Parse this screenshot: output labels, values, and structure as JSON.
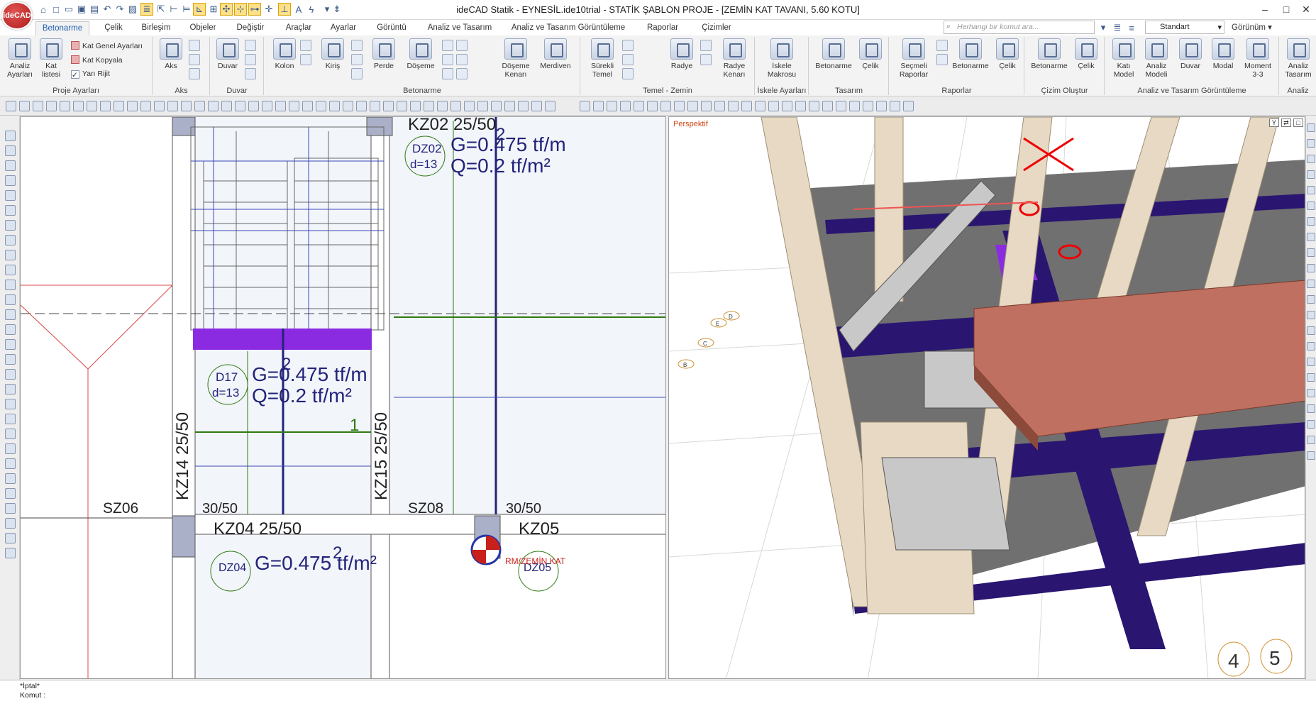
{
  "app": {
    "logo_text": "ideCAD",
    "window_title": "ideCAD Statik - EYNESİL.ide10trial - STATİK ŞABLON PROJE - [ZEMİN KAT TAVANI,  5.60 KOTU]"
  },
  "tabs": [
    "Betonarme",
    "Çelik",
    "Birleşim",
    "Objeler",
    "Değiştir",
    "Araçlar",
    "Ayarlar",
    "Görüntü",
    "Analiz ve Tasarım",
    "Analiz ve Tasarım Görüntüleme",
    "Raporlar",
    "Çizimler"
  ],
  "search": {
    "placeholder": "Herhangi bir komut ara..."
  },
  "style_select": {
    "value": "Standart"
  },
  "view_label": "Görünüm",
  "ribbon": {
    "groups": [
      {
        "label": "Proje Ayarları"
      },
      {
        "label": "Aks"
      },
      {
        "label": "Duvar"
      },
      {
        "label": "Betonarme"
      },
      {
        "label": "Temel - Zemin"
      },
      {
        "label": "İskele Ayarları"
      },
      {
        "label": "Tasarım"
      },
      {
        "label": "Raporlar"
      },
      {
        "label": "Çizim Oluştur"
      },
      {
        "label": "Analiz ve Tasarım Görüntüleme"
      },
      {
        "label": "Analiz"
      }
    ],
    "proje": {
      "analiz_l1": "Analiz",
      "analiz_l2": "Ayarları",
      "kat_l1": "Kat",
      "kat_l2": "listesi",
      "kat_genel": "Kat Genel Ayarları",
      "kat_kopyala": "Kat Kopyala",
      "yari_rijit": "Yarı Rijit"
    },
    "aks": {
      "l1": "Aks"
    },
    "duvar": {
      "l1": "Duvar"
    },
    "betonarme": {
      "kolon": "Kolon",
      "kiris": "Kiriş",
      "perde": "Perde",
      "doseme": "Döşeme",
      "doseme_kenari_l1": "Döşeme",
      "doseme_kenari_l2": "Kenarı",
      "merdiven": "Merdiven"
    },
    "temel": {
      "surekli_l1": "Sürekli",
      "surekli_l2": "Temel",
      "radye": "Radye",
      "radye_kenari_l1": "Radye",
      "radye_kenari_l2": "Kenarı"
    },
    "iskele": {
      "l1": "İskele",
      "l2": "Makrosu"
    },
    "tasarim": {
      "betonarme": "Betonarme",
      "celik": "Çelik"
    },
    "raporlar": {
      "secmeli_l1": "Seçmeli",
      "secmeli_l2": "Raporlar",
      "betonarme": "Betonarme",
      "celik": "Çelik"
    },
    "cizim": {
      "betonarme": "Betonarme",
      "celik": "Çelik"
    },
    "gorunt": {
      "kati_l1": "Katı",
      "kati_l2": "Model",
      "analiz_l1": "Analiz",
      "analiz_l2": "Modeli",
      "duvar": "Duvar",
      "modal": "Modal",
      "moment_l1": "Moment",
      "moment_l2": "3-3"
    },
    "analiz": {
      "l1": "Analiz",
      "l2": "Tasarım"
    }
  },
  "plan": {
    "labels": {
      "kz02": "KZ02 25/50",
      "kz04": "KZ04 25/50",
      "kz05": "KZ05",
      "kz14": "KZ14 25/50",
      "kz15": "KZ15 25/50",
      "sz06": "SZ06",
      "sz08": "SZ08",
      "c30a": "30/50",
      "c30b": "30/50",
      "dz02": "DZ02",
      "dz02_d": "d=13",
      "d17": "D17",
      "d17_d": "d=13",
      "dz04": "DZ04",
      "dz05": "DZ05",
      "g1": "G=0.475 tf/m",
      "q1": "Q=0.2 tf/m²",
      "g2": "G=0.475 tf/m",
      "q2": "Q=0.2 tf/m²",
      "g3": "G=0.475 tf/m²",
      "num2a": "2",
      "num2b": "2",
      "num2c": "2",
      "num1": "1",
      "rm": "RM/ZEMİN KAT"
    }
  },
  "perspective": {
    "label": "Perspektif",
    "axis_labels": [
      "D",
      "E",
      "C",
      "B",
      "4",
      "5"
    ]
  },
  "command_bar": {
    "line1": "*İptal*",
    "line2": "Komut :"
  },
  "colors": {
    "beam_purple": "#8a2be2",
    "beam_dark": "#2a1570",
    "slab_grey": "#6e6e6e",
    "column_beige": "#e7d9c3",
    "stair_red": "#c07060",
    "load_text": "#23237a",
    "green_line": "#2f7a12"
  }
}
